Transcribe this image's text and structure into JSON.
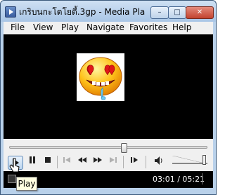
{
  "window": {
    "title": "เกริบนกะโดโยตี้.3gp - Media Pla...",
    "minimize_label": "–",
    "maximize_label": "□",
    "close_label": "✕"
  },
  "menu": {
    "items": [
      {
        "label": "File"
      },
      {
        "label": "View"
      },
      {
        "label": "Play"
      },
      {
        "label": "Navigate"
      },
      {
        "label": "Favorites"
      },
      {
        "label": "Help"
      }
    ]
  },
  "seek": {
    "position_fraction": 0.577
  },
  "controls": {
    "play_icon": "play-icon",
    "pause_icon": "pause-icon",
    "stop_icon": "stop-icon",
    "previous_icon": "skip-back-icon",
    "rewind_icon": "rewind-icon",
    "fast_forward_icon": "fast-forward-icon",
    "next_icon": "skip-forward-icon",
    "frame_step_icon": "frame-step-icon",
    "volume_icon": "speaker-icon",
    "volume_level": 0.9
  },
  "status": {
    "text": "ng",
    "time": "03:01 / 05:21"
  },
  "tooltip": {
    "text": "Play"
  },
  "colors": {
    "video_background": "#000000",
    "titlebar": "#b9d1ea",
    "status_background": "#000000"
  }
}
